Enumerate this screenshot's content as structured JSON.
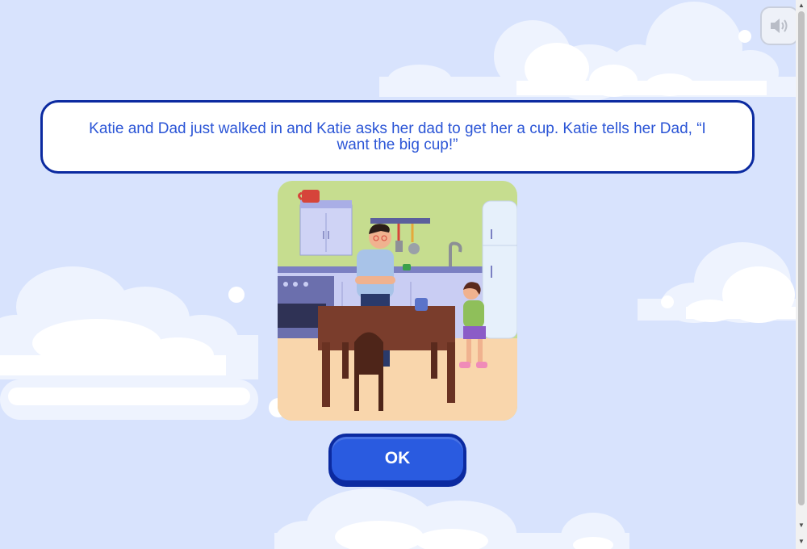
{
  "sound": {
    "icon": "speaker-icon"
  },
  "prompt": {
    "text": "Katie and Dad just walked in and Katie asks her dad to get her a cup. Katie tells her Dad, “I want the big cup!”"
  },
  "ok_button": {
    "label": "OK"
  },
  "colors": {
    "background": "#d8e3fd",
    "prompt_border": "#0b2aa0",
    "prompt_text": "#2b55d6",
    "button": "#2a5be0",
    "button_border": "#0b2aa0"
  }
}
